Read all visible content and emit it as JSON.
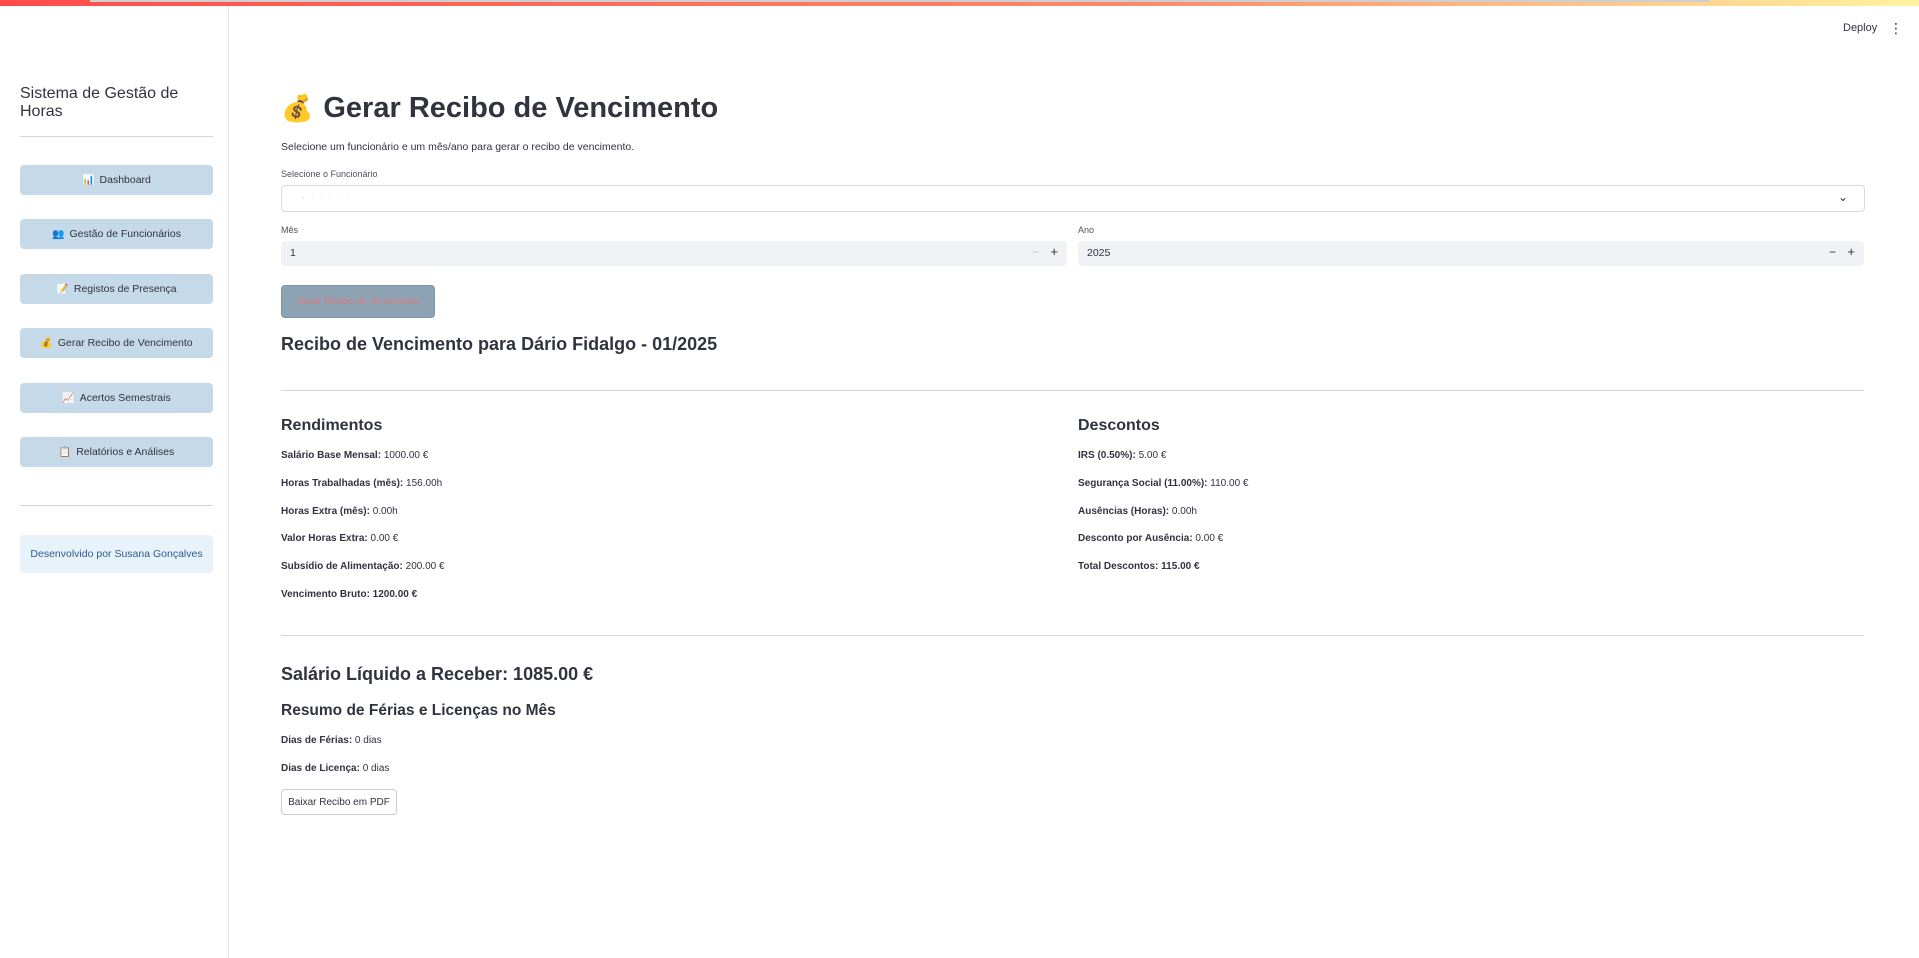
{
  "header": {
    "deploy_label": "Deploy",
    "menu_icon": "kebab-menu-icon"
  },
  "sidebar": {
    "title": "Sistema de Gestão de Horas",
    "items": [
      {
        "icon": "📊",
        "label": "Dashboard"
      },
      {
        "icon": "👥",
        "label": "Gestão de Funcionários"
      },
      {
        "icon": "📝",
        "label": "Registos de Presença"
      },
      {
        "icon": "💰",
        "label": "Gerar Recibo de Vencimento"
      },
      {
        "icon": "📈",
        "label": "Acertos Semestrais"
      },
      {
        "icon": "📋",
        "label": "Relatórios e Análises"
      }
    ],
    "developer": "Desenvolvido por Susana Gonçalves"
  },
  "page": {
    "emoji": "💰",
    "title": "Gerar Recibo de Vencimento",
    "subtitle": "Selecione um funcionário e um mês/ano para gerar o recibo de vencimento.",
    "employee_label": "Selecione o Funcionário",
    "employee_value": "· · · · · ·",
    "month_label": "Mês",
    "month_value": "1",
    "year_label": "Ano",
    "year_value": "2025",
    "generate_button": "Gerar Recibo de Vencimento",
    "receipt_title": "Recibo de Vencimento para Dário Fidalgo - 01/2025"
  },
  "earnings": {
    "heading": "Rendimentos",
    "rows": [
      {
        "label": "Salário Base Mensal:",
        "value": " 1000.00 €"
      },
      {
        "label": "Horas Trabalhadas (mês):",
        "value": " 156.00h"
      },
      {
        "label": "Horas Extra (mês):",
        "value": " 0.00h"
      },
      {
        "label": "Valor Horas Extra:",
        "value": " 0.00 €"
      },
      {
        "label": "Subsídio de Alimentação:",
        "value": " 200.00 €"
      },
      {
        "label": "Vencimento Bruto:",
        "value": " 1200.00 €"
      }
    ]
  },
  "deductions": {
    "heading": "Descontos",
    "rows": [
      {
        "label": "IRS (0.50%):",
        "value": " 5.00 €"
      },
      {
        "label": "Segurança Social (11.00%):",
        "value": " 110.00 €"
      },
      {
        "label": "Ausências (Horas):",
        "value": " 0.00h"
      },
      {
        "label": "Desconto por Ausência:",
        "value": " 0.00 €"
      },
      {
        "label": "Total Descontos:",
        "value": " 115.00 €"
      }
    ]
  },
  "net_salary": "Salário Líquido a Receber: 1085.00 €",
  "vacation": {
    "heading": "Resumo de Férias e Licenças no Mês",
    "rows": [
      {
        "label": "Dias de Férias:",
        "value": " 0 dias"
      },
      {
        "label": "Dias de Licença:",
        "value": " 0 dias"
      }
    ]
  },
  "download_button": "Baixar Recibo em PDF"
}
